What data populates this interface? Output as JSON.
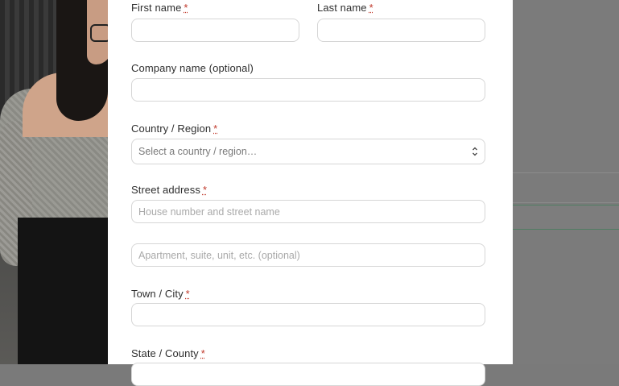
{
  "form": {
    "first_name": {
      "label": "First name",
      "required": "*",
      "value": ""
    },
    "last_name": {
      "label": "Last name",
      "required": "*",
      "value": ""
    },
    "company": {
      "label": "Company name (optional)",
      "value": ""
    },
    "country": {
      "label": "Country / Region",
      "required": "*",
      "selected": "Select a country / region…"
    },
    "street": {
      "label": "Street address",
      "required": "*",
      "placeholder_1": "House number and street name",
      "placeholder_2": "Apartment, suite, unit, etc. (optional)"
    },
    "town": {
      "label": "Town / City",
      "required": "*",
      "value": ""
    },
    "state": {
      "label": "State / County",
      "required": "*"
    }
  },
  "colors": {
    "required": "#c0392b",
    "border": "#d6d6d6",
    "overlay": "#7a7a7a"
  },
  "icons": {
    "select_arrow": "chevron-up-down-icon"
  }
}
